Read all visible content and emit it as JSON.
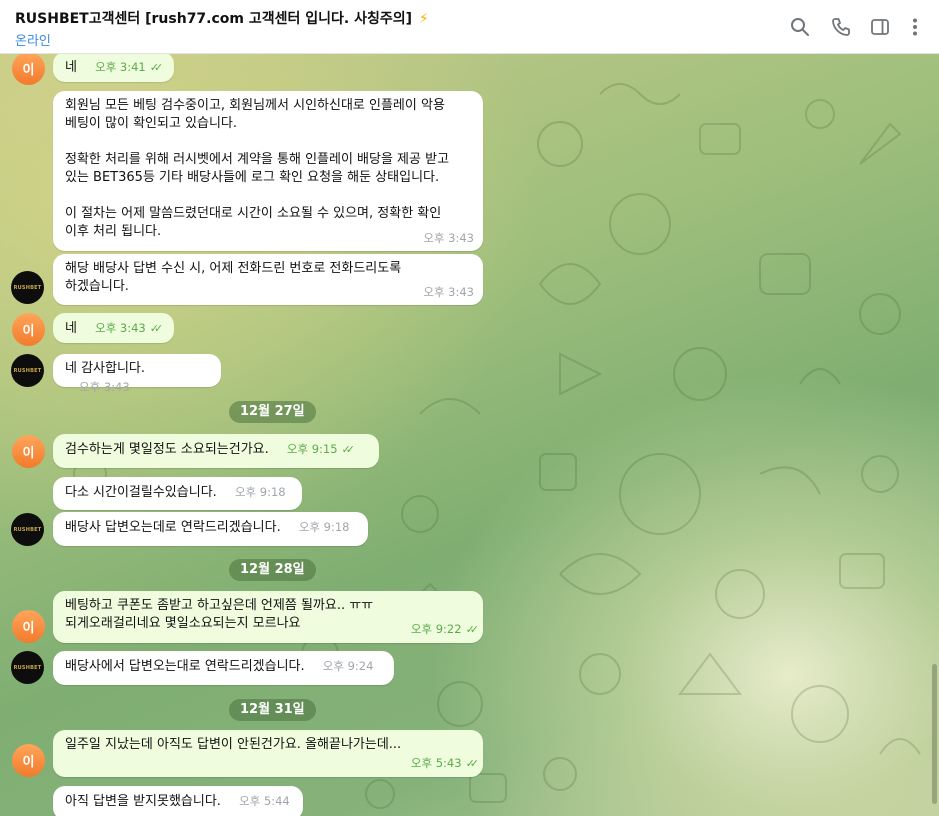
{
  "header": {
    "title": "RUSHBET고객센터 [rush77.com 고객센터 입니다. 사칭주의]",
    "title_emoji": "⚡",
    "status": "온라인",
    "icons": [
      "search-icon",
      "phone-icon",
      "sidebar-toggle-icon",
      "more-icon"
    ]
  },
  "avatars": {
    "user_initial": "이",
    "agent_brand": "RUSHBET"
  },
  "messages": [
    {
      "id": "m1",
      "side": "out",
      "text": "네",
      "time": "오후 3:41",
      "read": true
    },
    {
      "id": "m2",
      "side": "in",
      "text": "회원님 모든 베팅 검수중이고, 회원님께서 시인하신대로 인플레이 악용\n베팅이 많이 확인되고 있습니다.\n\n정확한 처리를 위해 러시벳에서 계약을 통해 인플레이 배당을 제공 받고\n있는 BET365등 기타 배당사들에 로그 확인 요청을 해둔 상태입니다.\n\n이 절차는 어제 말씀드렸던대로 시간이 소요될 수 있으며, 정확한 확인\n이후 처리 됩니다.",
      "time": "오후 3:43"
    },
    {
      "id": "m3",
      "side": "in",
      "text": "해당 배당사 답변 수신 시, 어제 전화드린 번호로 전화드리도록\n하겠습니다.",
      "time": "오후 3:43"
    },
    {
      "id": "m4",
      "side": "out",
      "text": "네",
      "time": "오후 3:43",
      "read": true
    },
    {
      "id": "m5",
      "side": "in",
      "text": "네 감사합니다.",
      "time": "오후 3:43"
    },
    {
      "id": "m6",
      "side": "out",
      "text": "검수하는게 몇일정도 소요되는건가요.",
      "time": "오후 9:15",
      "read": true
    },
    {
      "id": "m7",
      "side": "in",
      "text": "다소 시간이걸릴수있습니다.",
      "time": "오후 9:18"
    },
    {
      "id": "m8",
      "side": "in",
      "text": "배당사 답변오는데로 연락드리겠습니다.",
      "time": "오후 9:18"
    },
    {
      "id": "m9",
      "side": "out",
      "text": "베팅하고 쿠폰도 좀받고 하고싶은데 언제쯤 될까요.. ㅠㅠ\n되게오래걸리네요 몇일소요되는지 모르나요",
      "time": "오후 9:22",
      "read": true
    },
    {
      "id": "m10",
      "side": "in",
      "text": "배당사에서 답변오는대로 연락드리겠습니다.",
      "time": "오후 9:24"
    },
    {
      "id": "m11",
      "side": "out",
      "text": "일주일 지났는데 아직도 답변이 안된건가요. 올해끝나가는데...",
      "time": "오후 5:43",
      "read": true
    },
    {
      "id": "m12",
      "side": "in",
      "text": "아직 답변을 받지못했습니다.",
      "time": "오후 5:44"
    }
  ],
  "date_separators": [
    "12월 27일",
    "12월 28일",
    "12월 31일"
  ],
  "colors": {
    "outgoing_bubble": "#effdde",
    "incoming_bubble": "#ffffff",
    "read_check": "#5cab4a",
    "header_status": "#3a8dde"
  }
}
